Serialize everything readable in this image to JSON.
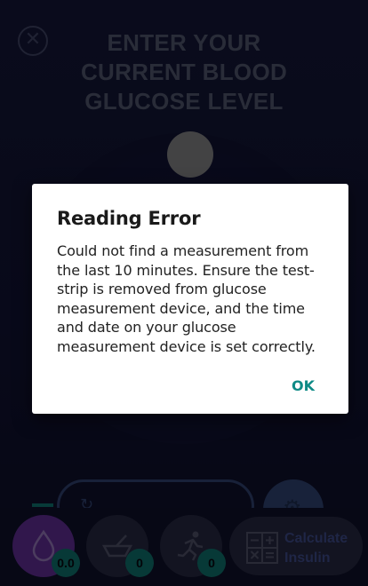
{
  "header": {
    "title_line1": "ENTER YOUR",
    "title_line2": "CURRENT BLOOD",
    "title_line3": "GLUCOSE LEVEL",
    "close_icon": "close-icon"
  },
  "bottom_nav": {
    "glucose": {
      "icon": "blood-drop-icon",
      "badge": "0.0"
    },
    "food": {
      "icon": "food-bowl-icon",
      "badge": "0"
    },
    "exercise": {
      "icon": "running-person-icon",
      "badge": "0"
    },
    "calculate": {
      "icon": "calculator-icon",
      "label_line1": "Calculate",
      "label_line2": "Insulin"
    }
  },
  "dialog": {
    "title": "Reading Error",
    "body": "Could not find a measurement from the last 10 minutes. Ensure the test-strip is removed from glucose measurement device, and the time and date on your glucose measurement device is set correctly.",
    "ok_label": "OK"
  },
  "colors": {
    "accent_teal": "#0e8a86",
    "active_tab_purple": "#5a2a8a",
    "background_navy": "#131533"
  }
}
